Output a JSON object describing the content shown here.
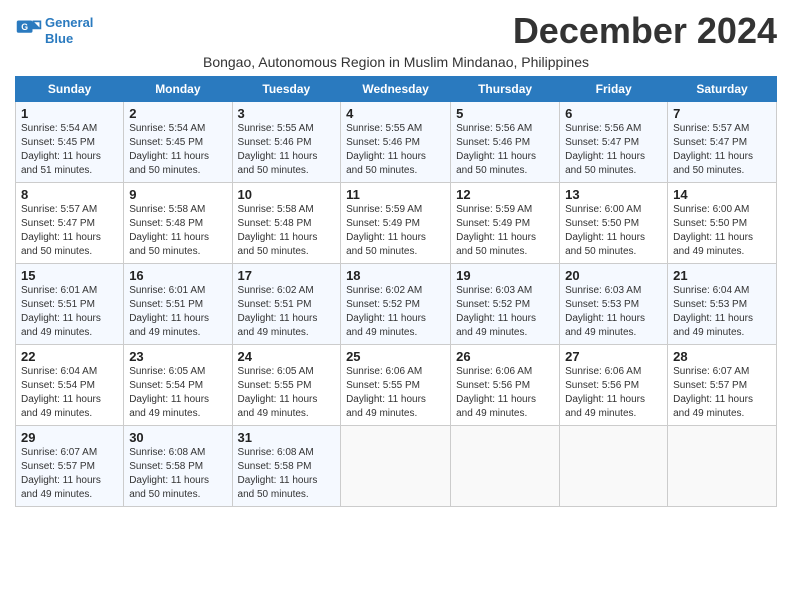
{
  "header": {
    "logo_line1": "General",
    "logo_line2": "Blue",
    "month_title": "December 2024",
    "subtitle": "Bongao, Autonomous Region in Muslim Mindanao, Philippines"
  },
  "weekdays": [
    "Sunday",
    "Monday",
    "Tuesday",
    "Wednesday",
    "Thursday",
    "Friday",
    "Saturday"
  ],
  "weeks": [
    [
      {
        "day": "1",
        "sunrise": "Sunrise: 5:54 AM",
        "sunset": "Sunset: 5:45 PM",
        "daylight": "Daylight: 11 hours and 51 minutes."
      },
      {
        "day": "2",
        "sunrise": "Sunrise: 5:54 AM",
        "sunset": "Sunset: 5:45 PM",
        "daylight": "Daylight: 11 hours and 50 minutes."
      },
      {
        "day": "3",
        "sunrise": "Sunrise: 5:55 AM",
        "sunset": "Sunset: 5:46 PM",
        "daylight": "Daylight: 11 hours and 50 minutes."
      },
      {
        "day": "4",
        "sunrise": "Sunrise: 5:55 AM",
        "sunset": "Sunset: 5:46 PM",
        "daylight": "Daylight: 11 hours and 50 minutes."
      },
      {
        "day": "5",
        "sunrise": "Sunrise: 5:56 AM",
        "sunset": "Sunset: 5:46 PM",
        "daylight": "Daylight: 11 hours and 50 minutes."
      },
      {
        "day": "6",
        "sunrise": "Sunrise: 5:56 AM",
        "sunset": "Sunset: 5:47 PM",
        "daylight": "Daylight: 11 hours and 50 minutes."
      },
      {
        "day": "7",
        "sunrise": "Sunrise: 5:57 AM",
        "sunset": "Sunset: 5:47 PM",
        "daylight": "Daylight: 11 hours and 50 minutes."
      }
    ],
    [
      {
        "day": "8",
        "sunrise": "Sunrise: 5:57 AM",
        "sunset": "Sunset: 5:47 PM",
        "daylight": "Daylight: 11 hours and 50 minutes."
      },
      {
        "day": "9",
        "sunrise": "Sunrise: 5:58 AM",
        "sunset": "Sunset: 5:48 PM",
        "daylight": "Daylight: 11 hours and 50 minutes."
      },
      {
        "day": "10",
        "sunrise": "Sunrise: 5:58 AM",
        "sunset": "Sunset: 5:48 PM",
        "daylight": "Daylight: 11 hours and 50 minutes."
      },
      {
        "day": "11",
        "sunrise": "Sunrise: 5:59 AM",
        "sunset": "Sunset: 5:49 PM",
        "daylight": "Daylight: 11 hours and 50 minutes."
      },
      {
        "day": "12",
        "sunrise": "Sunrise: 5:59 AM",
        "sunset": "Sunset: 5:49 PM",
        "daylight": "Daylight: 11 hours and 50 minutes."
      },
      {
        "day": "13",
        "sunrise": "Sunrise: 6:00 AM",
        "sunset": "Sunset: 5:50 PM",
        "daylight": "Daylight: 11 hours and 50 minutes."
      },
      {
        "day": "14",
        "sunrise": "Sunrise: 6:00 AM",
        "sunset": "Sunset: 5:50 PM",
        "daylight": "Daylight: 11 hours and 49 minutes."
      }
    ],
    [
      {
        "day": "15",
        "sunrise": "Sunrise: 6:01 AM",
        "sunset": "Sunset: 5:51 PM",
        "daylight": "Daylight: 11 hours and 49 minutes."
      },
      {
        "day": "16",
        "sunrise": "Sunrise: 6:01 AM",
        "sunset": "Sunset: 5:51 PM",
        "daylight": "Daylight: 11 hours and 49 minutes."
      },
      {
        "day": "17",
        "sunrise": "Sunrise: 6:02 AM",
        "sunset": "Sunset: 5:51 PM",
        "daylight": "Daylight: 11 hours and 49 minutes."
      },
      {
        "day": "18",
        "sunrise": "Sunrise: 6:02 AM",
        "sunset": "Sunset: 5:52 PM",
        "daylight": "Daylight: 11 hours and 49 minutes."
      },
      {
        "day": "19",
        "sunrise": "Sunrise: 6:03 AM",
        "sunset": "Sunset: 5:52 PM",
        "daylight": "Daylight: 11 hours and 49 minutes."
      },
      {
        "day": "20",
        "sunrise": "Sunrise: 6:03 AM",
        "sunset": "Sunset: 5:53 PM",
        "daylight": "Daylight: 11 hours and 49 minutes."
      },
      {
        "day": "21",
        "sunrise": "Sunrise: 6:04 AM",
        "sunset": "Sunset: 5:53 PM",
        "daylight": "Daylight: 11 hours and 49 minutes."
      }
    ],
    [
      {
        "day": "22",
        "sunrise": "Sunrise: 6:04 AM",
        "sunset": "Sunset: 5:54 PM",
        "daylight": "Daylight: 11 hours and 49 minutes."
      },
      {
        "day": "23",
        "sunrise": "Sunrise: 6:05 AM",
        "sunset": "Sunset: 5:54 PM",
        "daylight": "Daylight: 11 hours and 49 minutes."
      },
      {
        "day": "24",
        "sunrise": "Sunrise: 6:05 AM",
        "sunset": "Sunset: 5:55 PM",
        "daylight": "Daylight: 11 hours and 49 minutes."
      },
      {
        "day": "25",
        "sunrise": "Sunrise: 6:06 AM",
        "sunset": "Sunset: 5:55 PM",
        "daylight": "Daylight: 11 hours and 49 minutes."
      },
      {
        "day": "26",
        "sunrise": "Sunrise: 6:06 AM",
        "sunset": "Sunset: 5:56 PM",
        "daylight": "Daylight: 11 hours and 49 minutes."
      },
      {
        "day": "27",
        "sunrise": "Sunrise: 6:06 AM",
        "sunset": "Sunset: 5:56 PM",
        "daylight": "Daylight: 11 hours and 49 minutes."
      },
      {
        "day": "28",
        "sunrise": "Sunrise: 6:07 AM",
        "sunset": "Sunset: 5:57 PM",
        "daylight": "Daylight: 11 hours and 49 minutes."
      }
    ],
    [
      {
        "day": "29",
        "sunrise": "Sunrise: 6:07 AM",
        "sunset": "Sunset: 5:57 PM",
        "daylight": "Daylight: 11 hours and 49 minutes."
      },
      {
        "day": "30",
        "sunrise": "Sunrise: 6:08 AM",
        "sunset": "Sunset: 5:58 PM",
        "daylight": "Daylight: 11 hours and 50 minutes."
      },
      {
        "day": "31",
        "sunrise": "Sunrise: 6:08 AM",
        "sunset": "Sunset: 5:58 PM",
        "daylight": "Daylight: 11 hours and 50 minutes."
      },
      null,
      null,
      null,
      null
    ]
  ]
}
